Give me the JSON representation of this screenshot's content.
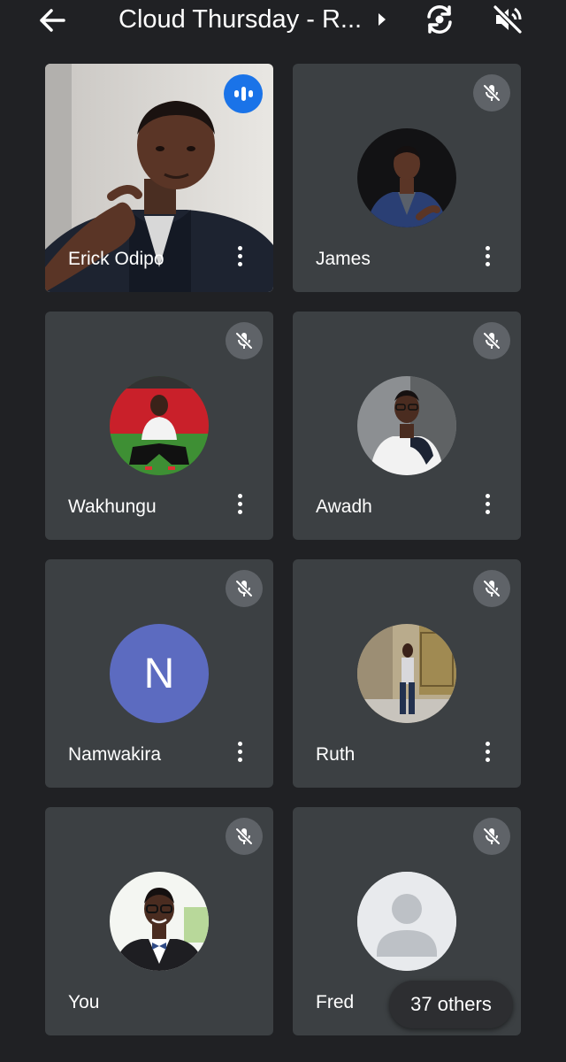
{
  "header": {
    "title": "Cloud Thursday - R...",
    "back_icon": "arrow-left-icon",
    "info_icon": "chevron-right-icon",
    "switch_camera_icon": "switch-camera-icon",
    "speaker_icon": "speaker-off-icon"
  },
  "participants": [
    {
      "name": "Erick Odipo",
      "state": "speaking",
      "video": true
    },
    {
      "name": "James",
      "state": "muted",
      "video": false
    },
    {
      "name": "Wakhungu",
      "state": "muted",
      "video": false
    },
    {
      "name": "Awadh",
      "state": "muted",
      "video": false
    },
    {
      "name": "Namwakira",
      "state": "muted",
      "video": false,
      "initial": "N"
    },
    {
      "name": "Ruth",
      "state": "muted",
      "video": false
    },
    {
      "name": "You",
      "state": "muted",
      "video": false
    },
    {
      "name": "Fred",
      "state": "muted",
      "video": false
    }
  ],
  "others": {
    "label": "37 others"
  },
  "colors": {
    "background": "#202124",
    "tile": "#3c4043",
    "mute_badge": "#5f6368",
    "speaking_badge": "#1a73e8",
    "letter_avatar": "#5c6bc0"
  }
}
